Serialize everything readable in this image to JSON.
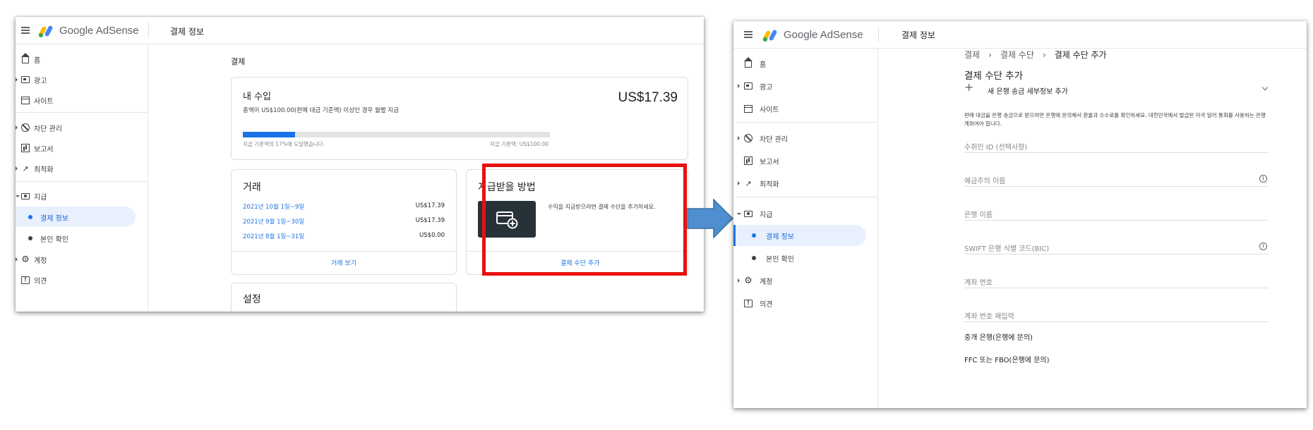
{
  "left": {
    "logo_text": "Google AdSense",
    "page_heading": "결제 정보",
    "nav": [
      {
        "label": "홈",
        "icon": "home-icon"
      },
      {
        "label": "광고",
        "icon": "ads-icon"
      },
      {
        "label": "사이트",
        "icon": "sites-icon"
      },
      {
        "label": "차단 관리",
        "icon": "block-icon"
      },
      {
        "label": "보고서",
        "icon": "report-icon"
      },
      {
        "label": "최적화",
        "icon": "optimization-icon"
      },
      {
        "label": "지급",
        "icon": "payments-icon"
      },
      {
        "label": "결제 정보"
      },
      {
        "label": "본인 확인"
      },
      {
        "label": "계정",
        "icon": "gear-icon"
      },
      {
        "label": "의견",
        "icon": "feedback-icon"
      }
    ],
    "section_title": "결제",
    "earnings": {
      "title": "내 수입",
      "amount": "US$17.39",
      "subtitle": "총액이 US$100.00(판매 대금 기준액) 이상인 경우 월별 지급",
      "progress_fraction": 0.17,
      "progress_note_left": "지급 기준액의 17%에 도달했습니다.",
      "progress_note_right": "지급 기준액: US$100.00"
    },
    "transactions": {
      "title": "거래",
      "rows": [
        {
          "date": "2021년 10월 1일~9일",
          "amount": "US$17.39"
        },
        {
          "date": "2021년 9월 1일~30일",
          "amount": "US$17.39"
        },
        {
          "date": "2021년 8월 1일~31일",
          "amount": "US$0.00"
        }
      ],
      "view_link": "거래 보기"
    },
    "payment_method": {
      "title": "지급받을 방법",
      "description": "수익을 지급받으려면 결제 수단을 추가하세요.",
      "add_link": "결제 수단 추가"
    },
    "settings_title": "설정"
  },
  "right": {
    "logo_text": "Google AdSense",
    "page_heading": "결제 정보",
    "nav": [
      {
        "label": "홈",
        "icon": "home-icon"
      },
      {
        "label": "광고",
        "icon": "ads-icon"
      },
      {
        "label": "사이트",
        "icon": "sites-icon"
      },
      {
        "label": "차단 관리",
        "icon": "block-icon"
      },
      {
        "label": "보고서",
        "icon": "report-icon"
      },
      {
        "label": "최적화",
        "icon": "optimization-icon"
      },
      {
        "label": "지급",
        "icon": "payments-icon"
      },
      {
        "label": "결제 정보"
      },
      {
        "label": "본인 확인"
      },
      {
        "label": "계정",
        "icon": "gear-icon"
      },
      {
        "label": "의견",
        "icon": "feedback-icon"
      }
    ],
    "breadcrumb": [
      "결제",
      "결제 수단",
      "결제 수단 추가"
    ],
    "form_title": "결제 수단 추가",
    "add_bank_label": "새 은행 송금 세부정보 추가",
    "notice": "판매 대금을 은행 송금으로 받으려면 은행에 문의해서 환율과 수수료를 확인하세요. 대한민국에서 발급된 미국 달러 통화를 사용하는 은행 계좌여야 합니다.",
    "fields": [
      {
        "label": "수취인 ID (선택사항)"
      },
      {
        "label": "예금주의 이름"
      },
      {
        "label": "은행 이름"
      },
      {
        "label": "SWIFT 은행 식별 코드(BIC)"
      },
      {
        "label": "계좌 번호"
      },
      {
        "label": "계좌 번호 재입력"
      }
    ],
    "intermediary_bank": "중개 은행(은행에 문의)",
    "ffc_fbo": "FFC 또는 FBO(은행에 문의)"
  },
  "colors": {
    "accent": "#1a73e8",
    "highlight_border": "#e8110f",
    "arrow_fill": "#4f8fcf",
    "active_nav_bg": "#e8f0fe"
  }
}
